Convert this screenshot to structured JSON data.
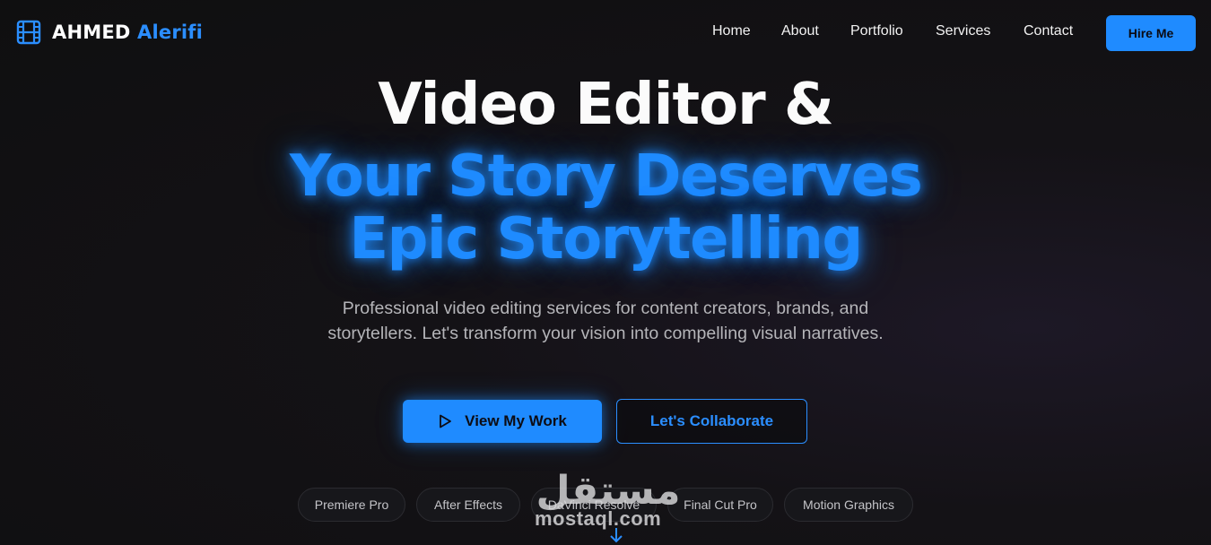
{
  "brand": {
    "first_name": "AHMED",
    "last_name": "Alerifi",
    "icon": "film-icon"
  },
  "nav": {
    "links": [
      "Home",
      "About",
      "Portfolio",
      "Services",
      "Contact"
    ],
    "hire_label": "Hire Me"
  },
  "hero": {
    "title_line1": "Video Editor &",
    "title_line2": "Your Story Deserves",
    "title_line3": "Epic Storytelling",
    "subtitle": "Professional video editing services for content creators, brands, and storytellers. Let's transform your vision into compelling visual narratives.",
    "primary_button": "View My Work",
    "secondary_button": "Let's Collaborate"
  },
  "skills": [
    "Premiere Pro",
    "After Effects",
    "DaVinci Resolve",
    "Final Cut Pro",
    "Motion Graphics"
  ],
  "watermark": {
    "latin": "mostaql.com",
    "arabic": "مستقل"
  },
  "colors": {
    "accent": "#1f8bff",
    "background": "#0f0f10",
    "text": "#ffffff",
    "muted": "#b5b5b9"
  }
}
